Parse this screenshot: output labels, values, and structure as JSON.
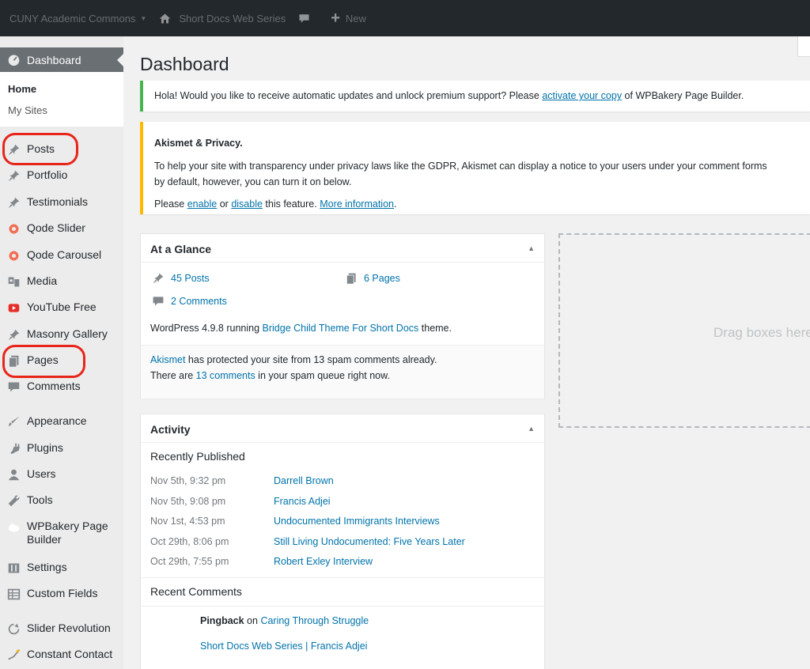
{
  "admin_bar": {
    "site_switcher": "CUNY Academic Commons",
    "switcher_arrow": "▼",
    "site_name": "Short Docs Web Series",
    "new_label": "New",
    "icons": [
      "home-icon",
      "comment-icon",
      "plus-icon"
    ]
  },
  "sidebar": {
    "dashboard": "Dashboard",
    "submenu": {
      "home": "Home",
      "my_sites": "My Sites"
    },
    "items": [
      {
        "label": "Posts",
        "icon": "pin-icon"
      },
      {
        "label": "Portfolio",
        "icon": "pin-icon"
      },
      {
        "label": "Testimonials",
        "icon": "pin-icon"
      },
      {
        "label": "Qode Slider",
        "icon": "qode-icon"
      },
      {
        "label": "Qode Carousel",
        "icon": "qode-icon"
      },
      {
        "label": "Media",
        "icon": "media-icon"
      },
      {
        "label": "YouTube Free",
        "icon": "youtube-icon"
      },
      {
        "label": "Masonry Gallery",
        "icon": "pin-icon"
      },
      {
        "label": "Pages",
        "icon": "pages-icon"
      },
      {
        "label": "Comments",
        "icon": "comment-icon"
      },
      {
        "label": "Appearance",
        "icon": "brush-icon"
      },
      {
        "label": "Plugins",
        "icon": "plug-icon"
      },
      {
        "label": "Users",
        "icon": "user-icon"
      },
      {
        "label": "Tools",
        "icon": "wrench-icon"
      },
      {
        "label": "WPBakery Page Builder",
        "icon": "cloud-icon"
      },
      {
        "label": "Settings",
        "icon": "settings-icon"
      },
      {
        "label": "Custom Fields",
        "icon": "table-icon"
      },
      {
        "label": "Slider Revolution",
        "icon": "refresh-icon"
      },
      {
        "label": "Constant Contact",
        "icon": "cc-icon"
      }
    ]
  },
  "main": {
    "title": "Dashboard",
    "notice1": {
      "before": "Hola! Would you like to receive automatic updates and unlock premium support? Please ",
      "link": "activate your copy",
      "after": " of WPBakery Page Builder."
    },
    "notice2": {
      "title": "Akismet & Privacy.",
      "line1": "To help your site with transparency under privacy laws like the GDPR, Akismet can display a notice to your users under your comment forms",
      "line2": "by default, however, you can turn it on below.",
      "please": "Please ",
      "enable": "enable",
      "or": " or ",
      "disable": "disable",
      "feature": " this feature. ",
      "more": "More information",
      "period": "."
    },
    "glance": {
      "title": "At a Glance",
      "toggle": "▲",
      "posts": "45 Posts",
      "pages": "6 Pages",
      "comments": "2 Comments",
      "wp_before": "WordPress 4.9.8 running ",
      "theme": "Bridge Child Theme For Short Docs",
      "wp_after": " theme.",
      "ak_link": "Akismet",
      "ak_text": " has protected your site from 13 spam comments already.",
      "spam_before": "There are ",
      "spam_link": "13 comments",
      "spam_after": " in your spam queue right now."
    },
    "activity": {
      "title": "Activity",
      "toggle": "▲",
      "recently_published": "Recently Published",
      "posts": [
        {
          "date": "Nov 5th, 9:32 pm",
          "title": "Darrell Brown"
        },
        {
          "date": "Nov 5th, 9:08 pm",
          "title": "Francis Adjei"
        },
        {
          "date": "Nov 1st, 4:53 pm",
          "title": "Undocumented Immigrants Interviews"
        },
        {
          "date": "Oct 29th, 8:06 pm",
          "title": "Still Living Undocumented: Five Years Later"
        },
        {
          "date": "Oct 29th, 7:55 pm",
          "title": "Robert Exley Interview"
        }
      ],
      "recent_comments": "Recent Comments",
      "comment1": {
        "type": "Pingback",
        "on": " on ",
        "link": "Caring Through Struggle"
      },
      "comment2": "Short Docs Web Series | Francis Adjei"
    },
    "drop_text": "Drag boxes here"
  }
}
